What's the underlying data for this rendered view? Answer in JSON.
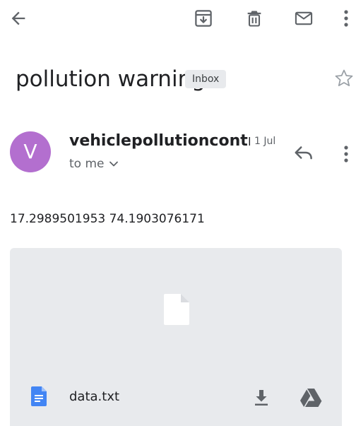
{
  "toolbar": {
    "back_icon": "arrow-back-icon",
    "archive_icon": "archive-icon",
    "delete_icon": "trash-icon",
    "mark_unread_icon": "mail-icon",
    "more_icon": "more-vert-icon"
  },
  "email": {
    "subject": "pollution warning",
    "label": "Inbox",
    "star_icon": "star-outline-icon",
    "avatar_letter": "V",
    "avatar_color": "#b36fcf",
    "sender": "vehiclepollutioncontr...",
    "date": "1 Jul",
    "recipient": "to me",
    "recipient_expand_icon": "chevron-down-icon",
    "reply_icon": "reply-icon",
    "body": "17.2989501953 74.1903076171"
  },
  "attachment": {
    "file_name": "data.txt",
    "file_icon_color": "#4285f4",
    "preview_icon": "file-icon",
    "download_icon": "download-icon",
    "drive_icon": "drive-icon"
  }
}
